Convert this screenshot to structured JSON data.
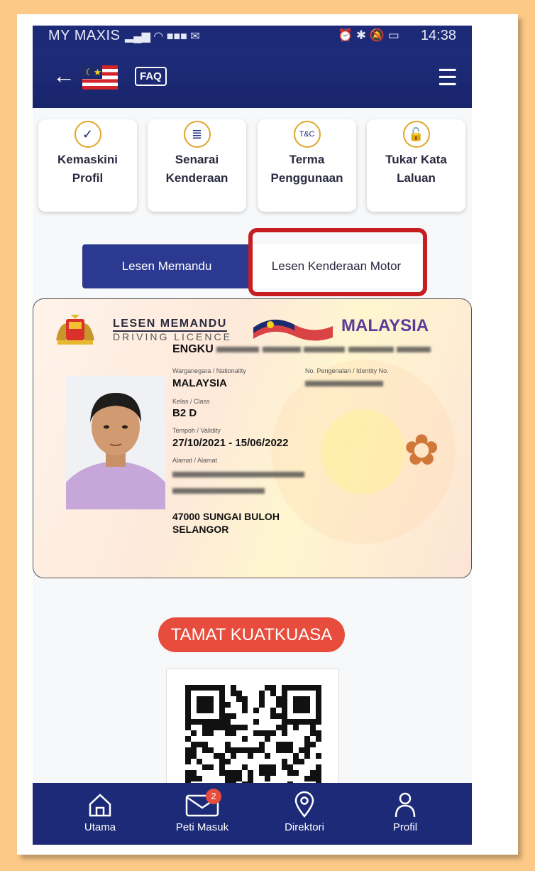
{
  "status_bar": {
    "carrier": "MY MAXIS",
    "time": "14:38"
  },
  "appbar": {
    "faq_label": "FAQ"
  },
  "cards": [
    {
      "line1": "Kemaskini",
      "line2": "Profil"
    },
    {
      "line1": "Senarai",
      "line2": "Kenderaan"
    },
    {
      "line1": "Terma",
      "line2": "Penggunaan"
    },
    {
      "line1": "Tukar Kata",
      "line2": "Laluan"
    }
  ],
  "tabs": {
    "active": "Lesen Memandu",
    "inactive": "Lesen Kenderaan Motor"
  },
  "license": {
    "title": "LESEN MEMANDU",
    "subtitle": "DRIVING LICENCE",
    "country": "MALAYSIA",
    "name_visible": "ENGKU",
    "nationality_label": "Warganegara / Nationality",
    "nationality": "MALAYSIA",
    "id_label": "No. Pengenalan / Identity No.",
    "class_label": "Kelas / Class",
    "class": "B2 D",
    "validity_label": "Tempoh / Validity",
    "validity": "27/10/2021 - 15/06/2022",
    "address_label": "Alamat / Alamat",
    "address_line3": "47000  SUNGAI BULOH",
    "address_line4": "SELANGOR"
  },
  "status_badge": "TAMAT KUATKUASA",
  "bottom_nav": [
    {
      "label": "Utama"
    },
    {
      "label": "Peti Masuk",
      "badge": "2"
    },
    {
      "label": "Direktori"
    },
    {
      "label": "Profil"
    }
  ],
  "colors": {
    "navy": "#1d2a78",
    "tab_active": "#2b3990",
    "highlight": "#c51d20",
    "badge": "#e74c3c",
    "background": "#fcc987"
  }
}
